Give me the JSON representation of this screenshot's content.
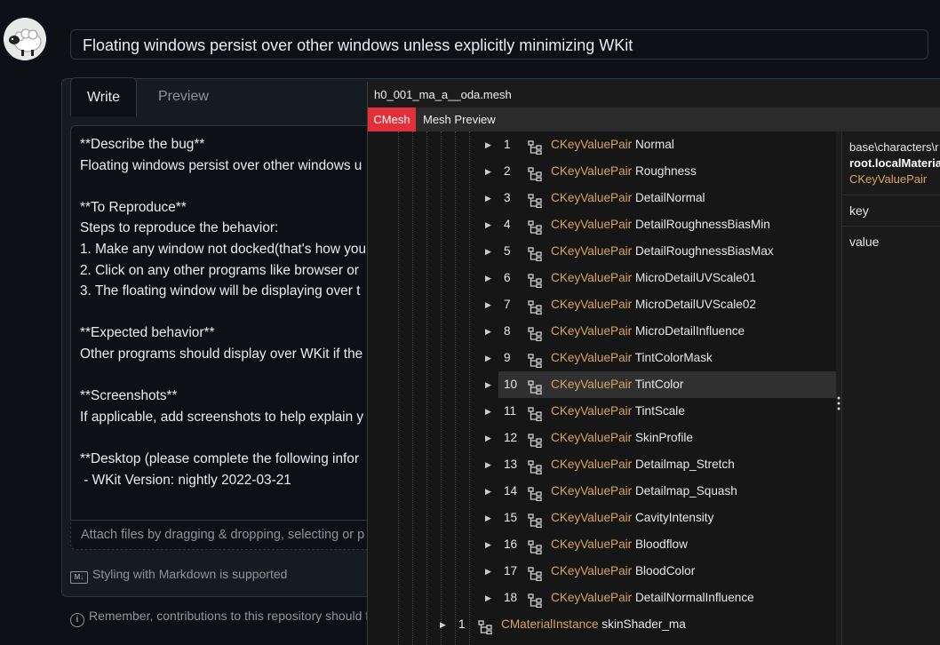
{
  "issue": {
    "title_value": "Floating windows persist over other windows unless explicitly minimizing WKit",
    "tabs": {
      "write": "Write",
      "preview": "Preview"
    },
    "body_lines": [
      "**Describe the bug**",
      "Floating windows persist over other windows u",
      "",
      "**To Reproduce**",
      "Steps to reproduce the behavior:",
      "1. Make any window not docked(that's how you",
      "2. Click on any other programs like browser or",
      "3. The floating window will be displaying over t",
      "",
      "**Expected behavior**",
      "Other programs should display over WKit if the",
      "",
      "**Screenshots**",
      "If applicable, add screenshots to help explain y",
      "",
      "**Desktop (please complete the following infor",
      " - WKit Version: nightly 2022-03-21"
    ],
    "attach_text": "Attach files by dragging & dropping, selecting or p",
    "markdown_icon": "M↓",
    "markdown_text": "Styling with Markdown is supported",
    "remember_icon": "i",
    "remember_text": "Remember, contributions to this repository should fo"
  },
  "floating_window": {
    "title": "h0_001_ma_a__oda.mesh",
    "tabs": {
      "cmesh": "CMesh",
      "mesh_preview": "Mesh Preview"
    },
    "tree_rows": [
      {
        "index": "1",
        "type": "CKeyValuePair",
        "name": "Normal"
      },
      {
        "index": "2",
        "type": "CKeyValuePair",
        "name": "Roughness"
      },
      {
        "index": "3",
        "type": "CKeyValuePair",
        "name": "DetailNormal"
      },
      {
        "index": "4",
        "type": "CKeyValuePair",
        "name": "DetailRoughnessBiasMin"
      },
      {
        "index": "5",
        "type": "CKeyValuePair",
        "name": "DetailRoughnessBiasMax"
      },
      {
        "index": "6",
        "type": "CKeyValuePair",
        "name": "MicroDetailUVScale01"
      },
      {
        "index": "7",
        "type": "CKeyValuePair",
        "name": "MicroDetailUVScale02"
      },
      {
        "index": "8",
        "type": "CKeyValuePair",
        "name": "MicroDetailInfluence"
      },
      {
        "index": "9",
        "type": "CKeyValuePair",
        "name": "TintColorMask"
      },
      {
        "index": "10",
        "type": "CKeyValuePair",
        "name": "TintColor",
        "selected": true
      },
      {
        "index": "11",
        "type": "CKeyValuePair",
        "name": "TintScale"
      },
      {
        "index": "12",
        "type": "CKeyValuePair",
        "name": "SkinProfile"
      },
      {
        "index": "13",
        "type": "CKeyValuePair",
        "name": "Detailmap_Stretch"
      },
      {
        "index": "14",
        "type": "CKeyValuePair",
        "name": "Detailmap_Squash"
      },
      {
        "index": "15",
        "type": "CKeyValuePair",
        "name": "CavityIntensity"
      },
      {
        "index": "16",
        "type": "CKeyValuePair",
        "name": "Bloodflow"
      },
      {
        "index": "17",
        "type": "CKeyValuePair",
        "name": "BloodColor"
      },
      {
        "index": "18",
        "type": "CKeyValuePair",
        "name": "DetailNormalInfluence"
      }
    ],
    "parent_row": {
      "index": "1",
      "type": "CMaterialInstance",
      "name": "skinShader_ma"
    },
    "properties": {
      "path": "base\\characters\\r",
      "name": "root.localMateria",
      "type": "CKeyValuePair",
      "rows": [
        "key",
        "value"
      ]
    }
  },
  "colors": {
    "accent_red": "#e0303a",
    "type_orange": "#d9a35f",
    "github_bg": "#0d1117"
  }
}
